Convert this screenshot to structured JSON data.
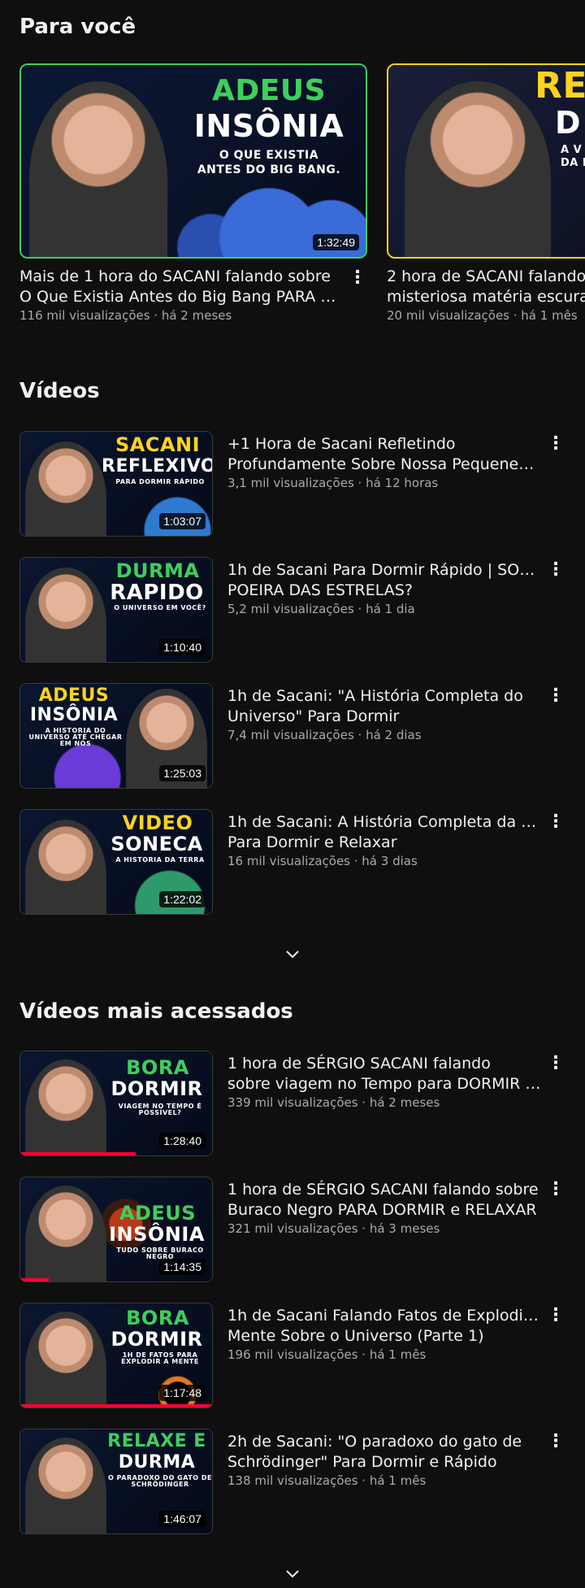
{
  "sections": {
    "for_you": "Para você",
    "videos": "Vídeos",
    "popular": "Vídeos mais acessados"
  },
  "shelf": [
    {
      "duration": "1:32:49",
      "thumb_text": [
        "ADEUS",
        "INSÔNIA",
        "O QUE EXISTIA",
        "ANTES DO BIG BANG."
      ],
      "title_line1": "Mais de 1 hora do SACANI falando sobre",
      "title_line2": "O Que Existia Antes do Big Bang PARA D...",
      "meta": "116 mil visualizações · há 2 meses"
    },
    {
      "thumb_text": [
        "RE",
        "D",
        "A V",
        "DA I"
      ],
      "title_line1": "2 hora de SACANI falando",
      "title_line2": "misteriosa matéria escura",
      "meta": "20 mil visualizações · há 1 mês"
    }
  ],
  "videos": [
    {
      "duration": "1:03:07",
      "thumb_text": [
        "SACANI",
        "REFLEXIVO",
        "PARA DORMIR RÁPIDO"
      ],
      "title_line1": "+1 Hora de Sacani Refletindo",
      "title_line2": "Profundamente Sobre Nossa Pequenez ...",
      "meta": "3,1 mil visualizações · há 12 horas"
    },
    {
      "duration": "1:10:40",
      "thumb_text": [
        "DURMA",
        "RAPIDO",
        "O UNIVERSO EM VOCÊ?"
      ],
      "title_line1": "1h de Sacani Para Dormir Rápido | SOMOS",
      "title_line2": "POEIRA DAS ESTRELAS?",
      "meta": "5,2 mil visualizações · há 1 dia"
    },
    {
      "duration": "1:25:03",
      "thumb_text": [
        "ADEUS",
        "INSÔNIA",
        "A HISTORIA DO UNIVERSO ATÉ CHEGAR EM NÓS"
      ],
      "title_line1": "1h de Sacani: \"A História Completa do",
      "title_line2": "Universo\" Para Dormir",
      "meta": "7,4 mil visualizações · há 2 dias"
    },
    {
      "duration": "1:22:02",
      "thumb_text": [
        "VIDEO",
        "SONECA",
        "A HISTORIA DA TERRA"
      ],
      "title_line1": "1h de Sacani: A História Completa da Terra",
      "title_line2": "Para Dormir e Relaxar",
      "meta": "16 mil visualizações · há 3 dias"
    }
  ],
  "popular": [
    {
      "duration": "1:28:40",
      "thumb_text": [
        "BORA",
        "DORMIR",
        "VIAGEM NO TEMPO É POSSÍVEL?"
      ],
      "title_line1": "1 hora de SÉRGIO SACANI falando",
      "title_line2": "sobre viagem no Tempo para DORMIR E ...",
      "meta": "339 mil visualizações · há 2 meses",
      "progress": 0.6
    },
    {
      "duration": "1:14:35",
      "thumb_text": [
        "ADEUS",
        "INSÔNIA",
        "TUDO SOBRE BURACO NEGRO"
      ],
      "title_line1": "1 hora de SÉRGIO SACANI falando sobre",
      "title_line2": "Buraco Negro PARA DORMIR e RELAXAR",
      "meta": "321 mil visualizações · há 3 meses",
      "progress": 0.15
    },
    {
      "duration": "1:17:48",
      "thumb_text": [
        "BORA",
        "DORMIR",
        "1H DE FATOS PARA EXPLODIR A MENTE"
      ],
      "title_line1": "1h de Sacani Falando Fatos de Explodir a",
      "title_line2": "Mente Sobre o Universo (Parte 1)",
      "meta": "196 mil visualizações · há 1 mês",
      "progress": 1.0
    },
    {
      "duration": "1:46:07",
      "thumb_text": [
        "RELAXE E",
        "DURMA",
        "O PARADOXO DO GATO DE SCHRÖDINGER"
      ],
      "title_line1": "2h de Sacani: \"O paradoxo do gato de",
      "title_line2": "Schrödinger\" Para Dormir e Rápido",
      "meta": "138 mil visualizações · há 1 mês"
    }
  ],
  "icons": {
    "more": "more-vert-icon",
    "expand": "chevron-down-icon"
  },
  "colors": {
    "background": "#0f0f0f",
    "green": "#3ecf5e",
    "yellow": "#ffd21e",
    "progress": "#ff0033"
  }
}
